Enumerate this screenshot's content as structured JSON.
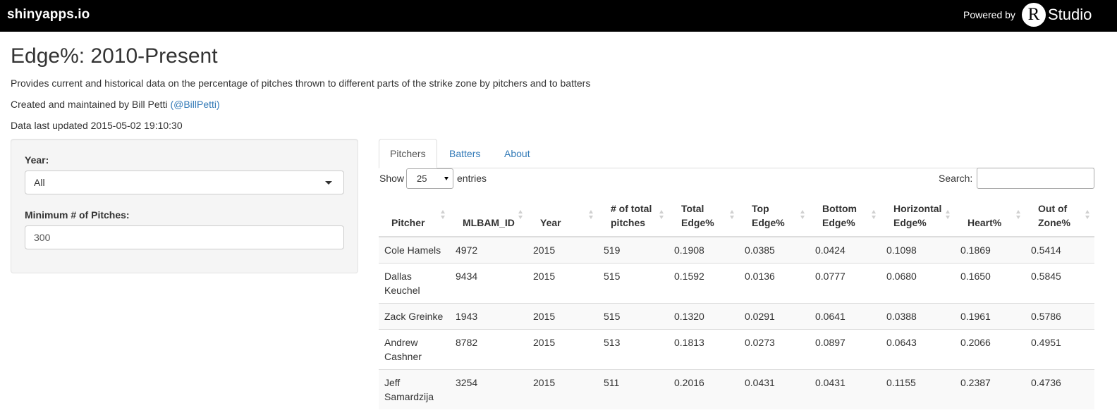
{
  "topbar": {
    "brand": "shinyapps.io",
    "powered_by": "Powered by",
    "r_letter": "R",
    "studio": "Studio"
  },
  "header": {
    "title": "Edge%: 2010-Present",
    "description": "Provides current and historical data on the percentage of pitches thrown to different parts of the strike zone by pitchers and to batters",
    "credit_prefix": "Created and maintained by Bill Petti",
    "credit_link": "(@BillPetti)",
    "updated": "Data last updated 2015-05-02 19:10:30"
  },
  "sidebar": {
    "year_label": "Year:",
    "year_value": "All",
    "min_pitches_label": "Minimum # of Pitches:",
    "min_pitches_value": "300"
  },
  "tabs": [
    {
      "label": "Pitchers",
      "active": true
    },
    {
      "label": "Batters",
      "active": false
    },
    {
      "label": "About",
      "active": false
    }
  ],
  "table_controls": {
    "show_label": "Show",
    "length_value": "25",
    "entries_label": "entries",
    "search_label": "Search:"
  },
  "table": {
    "columns": [
      [
        "Pitcher"
      ],
      [
        "MLBAM_ID"
      ],
      [
        "Year"
      ],
      [
        "# of total",
        "pitches"
      ],
      [
        "Total",
        "Edge%"
      ],
      [
        "Top",
        "Edge%"
      ],
      [
        "Bottom",
        "Edge%"
      ],
      [
        "Horizontal",
        "Edge%"
      ],
      [
        "Heart%"
      ],
      [
        "Out of",
        "Zone%"
      ]
    ],
    "rows": [
      [
        [
          "Cole Hamels"
        ],
        "4972",
        "2015",
        "519",
        "0.1908",
        "0.0385",
        "0.0424",
        "0.1098",
        "0.1869",
        "0.5414"
      ],
      [
        [
          "Dallas",
          "Keuchel"
        ],
        "9434",
        "2015",
        "515",
        "0.1592",
        "0.0136",
        "0.0777",
        "0.0680",
        "0.1650",
        "0.5845"
      ],
      [
        [
          "Zack Greinke"
        ],
        "1943",
        "2015",
        "515",
        "0.1320",
        "0.0291",
        "0.0641",
        "0.0388",
        "0.1961",
        "0.5786"
      ],
      [
        [
          "Andrew",
          "Cashner"
        ],
        "8782",
        "2015",
        "513",
        "0.1813",
        "0.0273",
        "0.0897",
        "0.0643",
        "0.2066",
        "0.4951"
      ],
      [
        [
          "Jeff",
          "Samardzija"
        ],
        "3254",
        "2015",
        "511",
        "0.2016",
        "0.0431",
        "0.0431",
        "0.1155",
        "0.2387",
        "0.4736"
      ]
    ]
  },
  "colors": {
    "topbar_bg": "#000000",
    "link": "#337ab7",
    "well_bg": "#f5f5f5",
    "stripe_bg": "#f9f9f9"
  }
}
